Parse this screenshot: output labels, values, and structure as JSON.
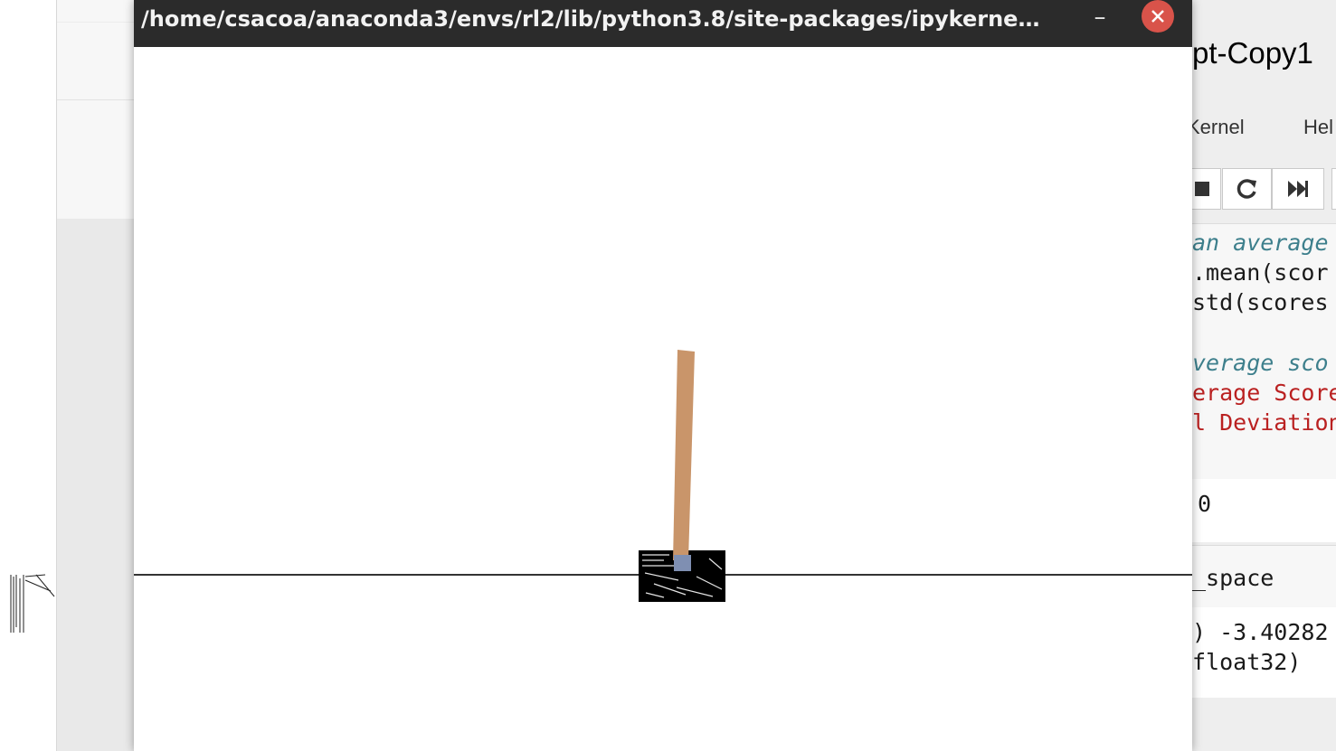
{
  "window": {
    "title": "/home/csacoa/anaconda3/envs/rl2/lib/python3.8/site-packages/ipykerne…",
    "minimize_symbol": "–",
    "close_symbol": "✕",
    "close_color": "#d9534a",
    "titlebar_color": "#2b2b2b"
  },
  "scene": {
    "pole_color": "#c9956a",
    "cart_color": "#000000",
    "axle_color": "#7f8fb2",
    "track_color": "#333333"
  },
  "notebook": {
    "title": "pt-Copy1",
    "menu": {
      "kernel": "Kernel",
      "help": "Hel"
    },
    "toolbar": {
      "stop_icon": "stop-icon",
      "restart_icon": "restart-icon",
      "run_all_icon": "fast-forward-icon"
    },
    "code_lines": [
      {
        "text": "an average",
        "kind": "comment"
      },
      {
        "text": ".mean(scor",
        "kind": "plain"
      },
      {
        "text": "std(scores",
        "kind": "plain"
      },
      {
        "text": "verage sco",
        "kind": "comment"
      },
      {
        "text": "erage Score",
        "kind": "string"
      },
      {
        "text": "l Deviation",
        "kind": "string"
      }
    ],
    "output_1": "0",
    "code_2": "_space",
    "output_2": [
      ") -3.40282",
      "float32)"
    ]
  }
}
